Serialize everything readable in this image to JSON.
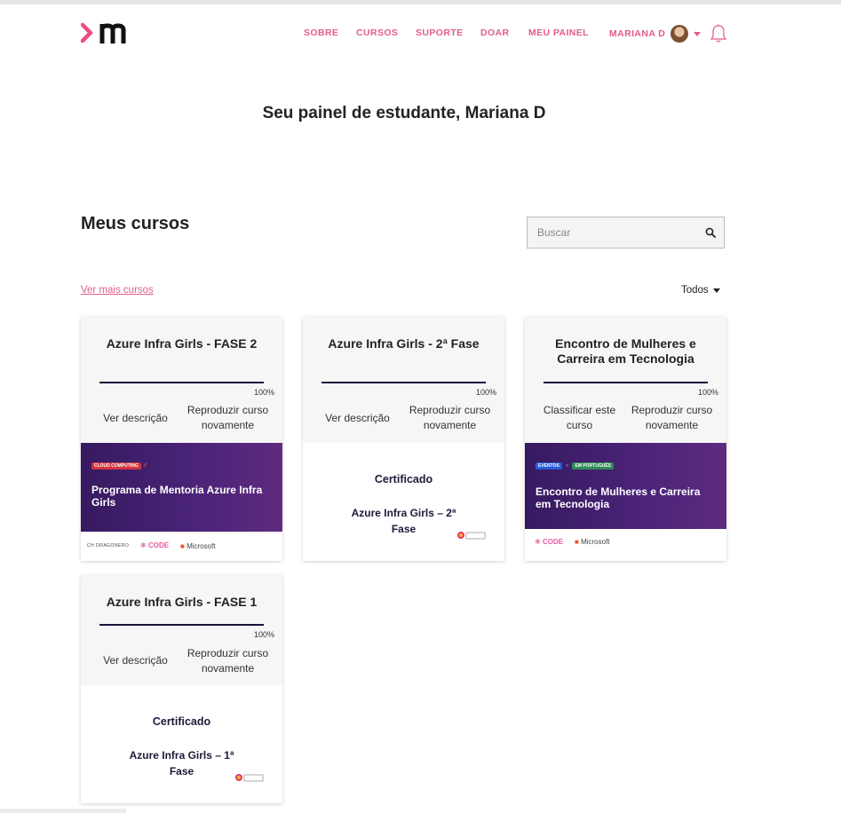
{
  "header": {
    "nav": [
      "SOBRE",
      "CURSOS",
      "SUPORTE",
      "DOAR",
      "MEU PAINEL"
    ],
    "user_name": "MARIANA D"
  },
  "page_title": "Seu painel de estudante, Mariana D",
  "courses_section": {
    "title": "Meus cursos",
    "search_placeholder": "Buscar",
    "more_link": "Ver mais cursos",
    "filter_label": "Todos"
  },
  "cards": [
    {
      "title": "Azure Infra Girls - FASE 2",
      "progress": 100,
      "progress_label": "100%",
      "action_left": "Ver descrição",
      "action_right": "Reproduzir curso novamente",
      "banner_tags": [
        "CLOUD COMPUTING"
      ],
      "banner_title": "Programa de Mentoria Azure Infra Girls",
      "banner_logos": [
        "CH DRAGONERO",
        "CODE",
        "Microsoft"
      ]
    },
    {
      "title": "Azure Infra Girls - 2ª Fase",
      "progress": 100,
      "progress_label": "100%",
      "action_left": "Ver descrição",
      "action_right": "Reproduzir curso novamente",
      "cert_title": "Certificado",
      "cert_subtitle": "Azure Infra Girls – 2ª Fase"
    },
    {
      "title": "Encontro de Mulheres e Carreira em Tecnologia",
      "progress": 100,
      "progress_label": "100%",
      "action_left": "Classificar este curso",
      "action_right": "Reproduzir curso novamente",
      "banner_tags": [
        "EVENTOS",
        "EM PORTUGUÊS"
      ],
      "banner_title": "Encontro de Mulheres e Carreira em Tecnologia",
      "banner_logos": [
        "CODE",
        "Microsoft"
      ]
    },
    {
      "title": "Azure Infra Girls - FASE 1",
      "progress": 100,
      "progress_label": "100%",
      "action_left": "Ver descrição",
      "action_right": "Reproduzir curso novamente",
      "cert_title": "Certificado",
      "cert_subtitle": "Azure Infra Girls – 1ª Fase"
    }
  ],
  "colors": {
    "accent": "#e45c8c",
    "progress": "#14143c",
    "banner": "#4a2377"
  }
}
